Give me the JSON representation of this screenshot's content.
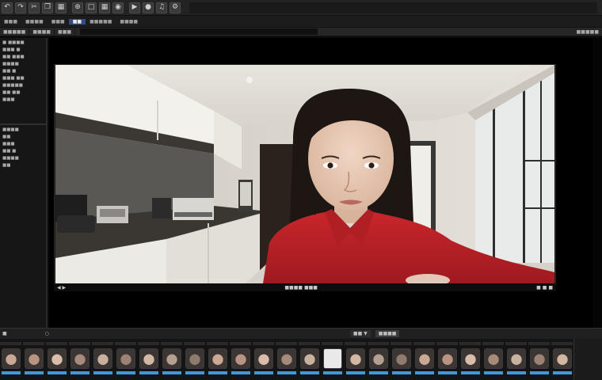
{
  "menu": {
    "items": [
      "  &#8226;&#8226;&#8226;&#8226;",
      "&#1054;&#1083;&#1099;&#1086;",
      "&#8226;&#8226;&#8226;&#8226;&#8226;&#8226;",
      "&#8226;&#8226;&#8226;&#8226;",
      "&#8226;&#8226;&#8226;&#8226;&#8226;",
      "&#8226;&#8226;&#8226;"
    ]
  },
  "options": {
    "items": [
      "&#8226;&#8226;&#8226;&#8226;&#8226;&#8226;",
      "&#8226;&#8226;&#8226;&#8226;&#8226;&#8226;",
      "&#8226;&#8226;&#8226;&#8226;"
    ],
    "right": "&#8226;&#8226;&#8226;&#8226;&#8226;&#8226;"
  },
  "viewer": {
    "footer_center": "&#8226;&#8226;&#8226;&#8226;&#8226;&#8226;&#8226;&#8226;",
    "footer_right": "&#8226;&#8226;&#8226;&#8226;"
  },
  "filmstrip": {
    "label": "&#8226;&#8226;",
    "label2": "&#8226;&#8226;&#8226;&#8226;&#8226;",
    "thumb_count": 25,
    "selected_index": 14,
    "accent": "#3b9bd6"
  },
  "icons": [
    "undo-icon",
    "redo-icon",
    "zoom-icon",
    "crop-icon",
    "grid-icon",
    "settings-icon"
  ]
}
